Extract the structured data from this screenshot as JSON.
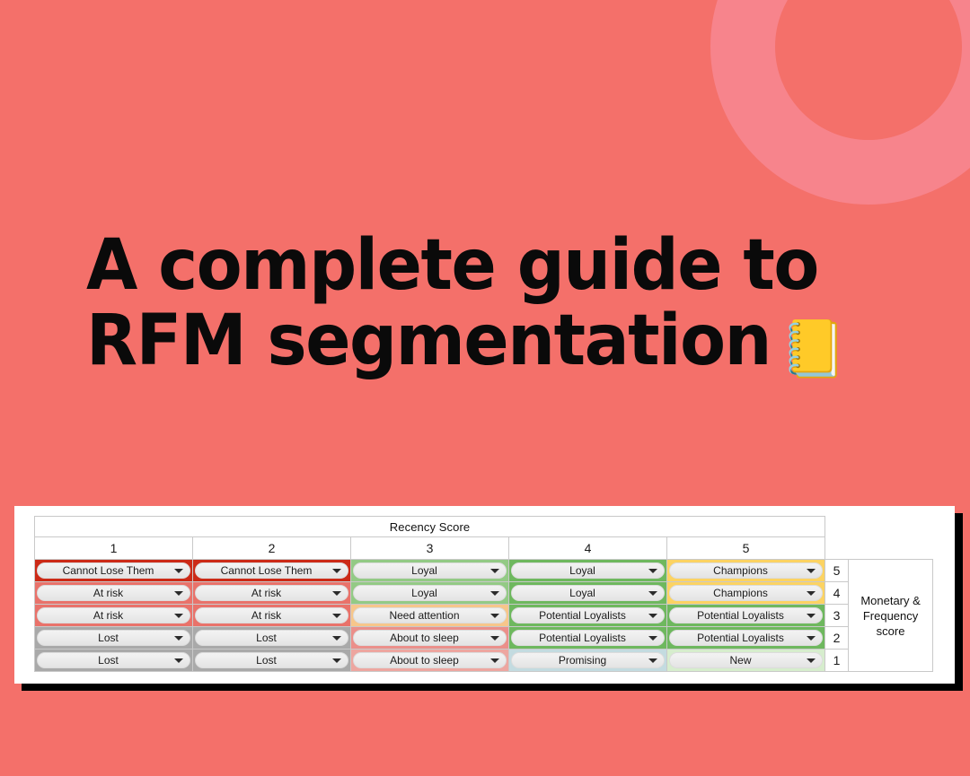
{
  "theme": {
    "background_color": "#f4706a",
    "ring_color": "#f7848c",
    "card_background": "#ffffff",
    "shadow_color": "#000000",
    "title_color": "#0a0a0a"
  },
  "hero": {
    "line1": "A complete guide to",
    "line2": "RFM segmentation",
    "emoji": "📒",
    "emoji_name": "ledger-notebook-emoji"
  },
  "table": {
    "recency_header": "Recency Score",
    "monetary_header": "Monetary & Frequency score",
    "monetary_header_lines": [
      "Monetary &",
      "Frequency",
      "score"
    ],
    "recency_columns": [
      "1",
      "2",
      "3",
      "4",
      "5"
    ],
    "monetary_scores": [
      "5",
      "4",
      "3",
      "2",
      "1"
    ],
    "caret_icon": "chevron-down-icon",
    "rows": [
      {
        "score": "5",
        "cells": [
          {
            "label": "Cannot Lose Them",
            "bg": "#cc2a17"
          },
          {
            "label": "Cannot Lose Them",
            "bg": "#cc2a17"
          },
          {
            "label": "Loyal",
            "bg": "#93ca85"
          },
          {
            "label": "Loyal",
            "bg": "#6eb85e"
          },
          {
            "label": "Champions",
            "bg": "#fcd362"
          }
        ]
      },
      {
        "score": "4",
        "cells": [
          {
            "label": "At risk",
            "bg": "#e9726a"
          },
          {
            "label": "At risk",
            "bg": "#e9726a"
          },
          {
            "label": "Loyal",
            "bg": "#93ca85"
          },
          {
            "label": "Loyal",
            "bg": "#6eb85e"
          },
          {
            "label": "Champions",
            "bg": "#fcd362"
          }
        ]
      },
      {
        "score": "3",
        "cells": [
          {
            "label": "At risk",
            "bg": "#e9726a"
          },
          {
            "label": "At risk",
            "bg": "#e9726a"
          },
          {
            "label": "Need attention",
            "bg": "#f7c68a"
          },
          {
            "label": "Potential Loyalists",
            "bg": "#6eb85e"
          },
          {
            "label": "Potential Loyalists",
            "bg": "#6eb85e"
          }
        ]
      },
      {
        "score": "2",
        "cells": [
          {
            "label": "Lost",
            "bg": "#a9a9a9"
          },
          {
            "label": "Lost",
            "bg": "#a9a9a9"
          },
          {
            "label": "About to sleep",
            "bg": "#eb8f8a"
          },
          {
            "label": "Potential Loyalists",
            "bg": "#6eb85e"
          },
          {
            "label": "Potential Loyalists",
            "bg": "#6eb85e"
          }
        ]
      },
      {
        "score": "1",
        "cells": [
          {
            "label": "Lost",
            "bg": "#a9a9a9"
          },
          {
            "label": "Lost",
            "bg": "#a9a9a9"
          },
          {
            "label": "About to sleep",
            "bg": "#eda6a0"
          },
          {
            "label": "Promising",
            "bg": "#c3dbe0"
          },
          {
            "label": "New",
            "bg": "#d6edcd"
          }
        ]
      }
    ]
  }
}
